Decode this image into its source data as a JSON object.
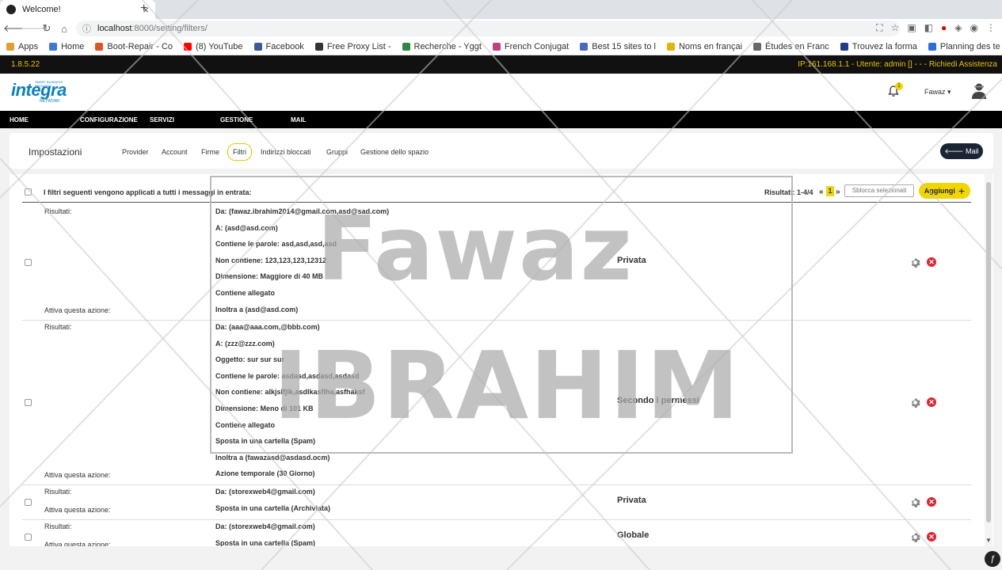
{
  "browser": {
    "tab_title": "Welcome!",
    "tab_close": "×",
    "new_tab": "+",
    "url_host": "localhost",
    "url_path": ":8000/setting/filters/",
    "bookmarks": [
      {
        "label": "Apps",
        "color": "#e0a030"
      },
      {
        "label": "Home",
        "color": "#3b78d8"
      },
      {
        "label": "Boot-Repair - Co",
        "color": "#dd5522"
      },
      {
        "label": "(8) YouTube",
        "color": "#ff0000"
      },
      {
        "label": "Facebook",
        "color": "#3b5998"
      },
      {
        "label": "Free Proxy List -",
        "color": "#333333"
      },
      {
        "label": "Recherche - Yggt",
        "color": "#2b8a3e"
      },
      {
        "label": "French Conjugat",
        "color": "#c04080"
      },
      {
        "label": "Best 15 sites to l",
        "color": "#4a69bd"
      },
      {
        "label": "Noms en françai",
        "color": "#e6b400"
      },
      {
        "label": "Études en Franc",
        "color": "#666666"
      },
      {
        "label": "Trouvez la forma",
        "color": "#1f3c88"
      },
      {
        "label": "Planning des te",
        "color": "#2d6cdf"
      }
    ]
  },
  "app": {
    "version": "1.8.5.22",
    "connection_info": "IP:161.168.1.1 - Utente: admin [] - - - Richiedi Assistenza",
    "logo_text": "integra",
    "logo_sub": "NETWORK",
    "logo_tiny": "SMART BUSINESS PROVIDER",
    "notification_count": "1",
    "user_name": "Fawaz ▾",
    "menu": [
      "HOME",
      "CONFIGURAZIONE",
      "SERVIZI",
      "GESTIONE",
      "MAIL"
    ]
  },
  "settings": {
    "title": "Impostazioni",
    "tabs": [
      "Provider",
      "Account",
      "Firme",
      "Filtri",
      "Indirizzi bloccati",
      "Gruppi",
      "Gestione dello spazio"
    ],
    "active_tab": "Filtri",
    "mail_button": "🡐 Mail"
  },
  "filters": {
    "header_text": "I filtri seguenti vengono applicati a tutti i messaggi in entrata:",
    "results_label": "Risultati: 1-4/4",
    "prev": "«",
    "page": "1",
    "next": "»",
    "unlock_button": "Sblocca selezionati",
    "add_button": "Aggiungi",
    "results_row_label": "Risultati:",
    "action_row_label": "Attiva questa azione:",
    "rows": [
      {
        "conditions": [
          "Da: (fawaz.ibrahim2014@gmail.com,asd@sad.com)",
          "A: (asd@asd.com)",
          "Contiene le parole: asd,asd,asd,asd",
          "Non contiene: 123,123,123,12312",
          "Dimensione: Maggiore di 40 MB",
          "Contiene allegato",
          "Inoltra a (asd@asd.com)"
        ],
        "scope": "Privata"
      },
      {
        "conditions": [
          "Da: (aaa@aaa.com,@bbb.com)",
          "A: (zzz@zzz.com)",
          "Oggetto: sur sur sur",
          "Contiene le parole: asdasd,asdasd,asdasd",
          "Non contiene: alkjslfjlk,asdlkasflha,asfhaksf",
          "Dimensione: Meno di 101 KB",
          "Contiene allegato",
          "Sposta in una cartella (Spam)",
          "Inoltra a (fawazasd@asdasd.ocm)",
          "Azione temporale (30 Giorno)"
        ],
        "scope": "Secondo i permessi"
      },
      {
        "conditions": [
          "Da: (storexweb4@gmail.com)",
          "Sposta in una cartella (Archiviata)"
        ],
        "scope": "Privata"
      },
      {
        "conditions": [
          "Da: (storexweb4@gmail.com)",
          "Sposta in una cartella (Spam)"
        ],
        "scope": "Globale"
      }
    ]
  },
  "watermark": {
    "line1": "Fawaz",
    "line2": "IBRAHIM"
  },
  "icons": {
    "delete": "✕",
    "corner": "ƒ"
  }
}
